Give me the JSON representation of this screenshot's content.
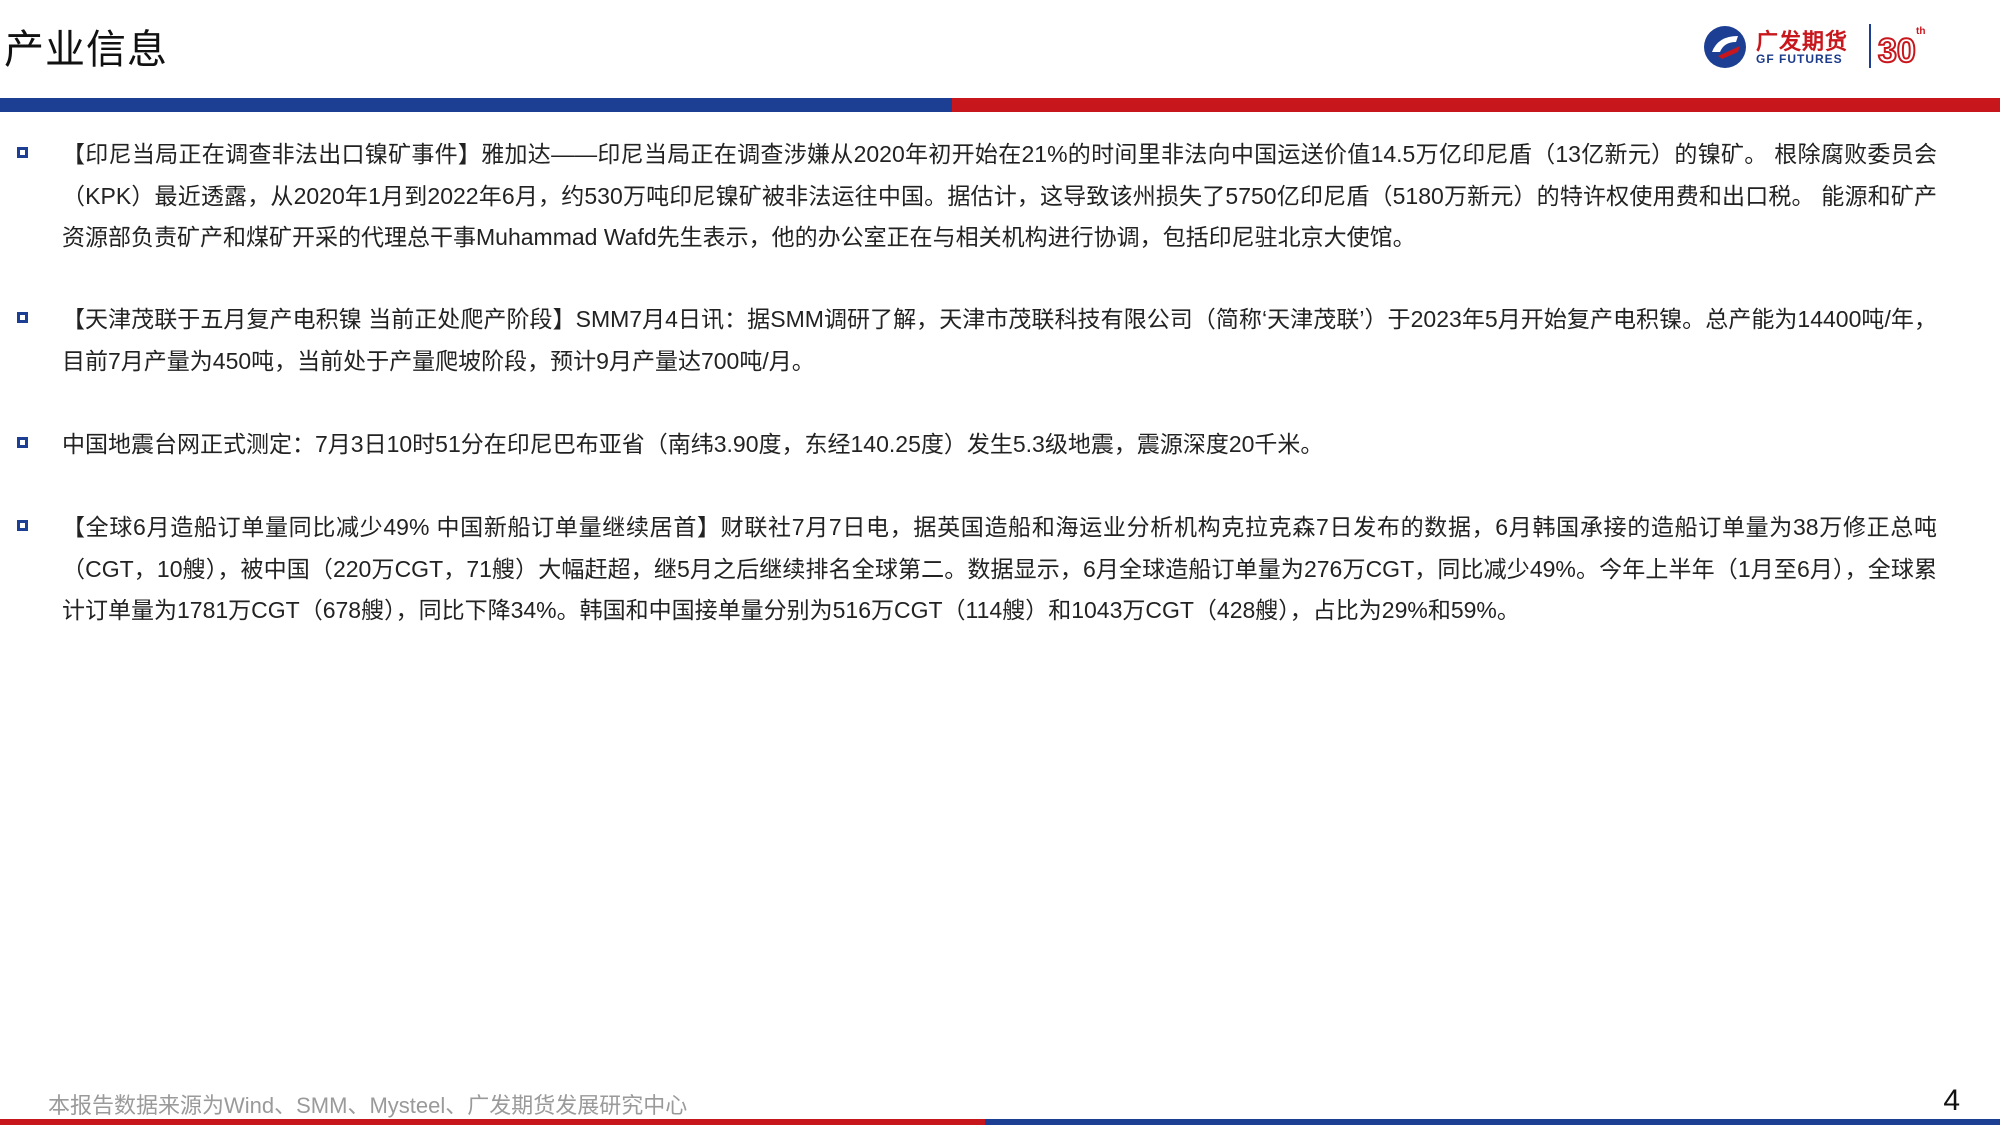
{
  "header": {
    "title": "产业信息",
    "logo": {
      "name_cn": "广发期货",
      "name_en": "GF FUTURES",
      "anniversary": "30",
      "anniversary_suffix": "th"
    }
  },
  "items": [
    {
      "text": "【印尼当局正在调查非法出口镍矿事件】雅加达——印尼当局正在调查涉嫌从2020年初开始在21%的时间里非法向中国运送价值14.5万亿印尼盾（13亿新元）的镍矿。 根除腐败委员会（KPK）最近透露，从2020年1月到2022年6月，约530万吨印尼镍矿被非法运往中国。据估计，这导致该州损失了5750亿印尼盾（5180万新元）的特许权使用费和出口税。 能源和矿产资源部负责矿产和煤矿开采的代理总干事Muhammad Wafd先生表示，他的办公室正在与相关机构进行协调，包括印尼驻北京大使馆。"
    },
    {
      "text": "【天津茂联于五月复产电积镍 当前正处爬产阶段】SMM7月4日讯：据SMM调研了解，天津市茂联科技有限公司（简称‘天津茂联’）于2023年5月开始复产电积镍。总产能为14400吨/年，目前7月产量为450吨，当前处于产量爬坡阶段，预计9月产量达700吨/月。"
    },
    {
      "text": "中国地震台网正式测定：7月3日10时51分在印尼巴布亚省（南纬3.90度，东经140.25度）发生5.3级地震，震源深度20千米。"
    },
    {
      "text": "【全球6月造船订单量同比减少49% 中国新船订单量继续居首】财联社7月7日电，据英国造船和海运业分析机构克拉克森7日发布的数据，6月韩国承接的造船订单量为38万修正总吨（CGT，10艘），被中国（220万CGT，71艘）大幅赶超，继5月之后继续排名全球第二。数据显示，6月全球造船订单量为276万CGT，同比减少49%。今年上半年（1月至6月），全球累计订单量为1781万CGT（678艘），同比下降34%。韩国和中国接单量分别为516万CGT（114艘）和1043万CGT（428艘），占比为29%和59%。"
    }
  ],
  "footer": {
    "source": "本报告数据来源为Wind、SMM、Mysteel、广发期货发展研究中心",
    "page_number": "4"
  },
  "colors": {
    "brand_blue": "#1c3f94",
    "brand_red": "#c8161d",
    "footer_gray": "#9a9a9a"
  },
  "icons": {
    "bullet": "hollow-square-icon",
    "logo": "gf-futures-logo-icon"
  }
}
